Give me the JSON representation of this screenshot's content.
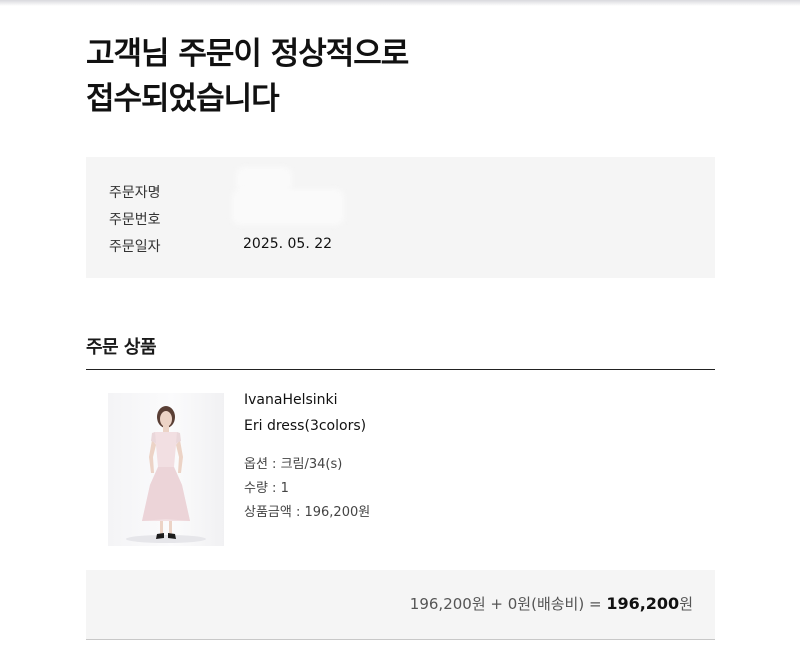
{
  "page": {
    "title_line1": "고객님 주문이 정상적으로",
    "title_line2": "접수되었습니다"
  },
  "order_info": {
    "orderer_label": "주문자명",
    "order_number_label": "주문번호",
    "order_date_label": "주문일자",
    "order_date": "2025. 05. 22"
  },
  "products_section": {
    "title": "주문 상품"
  },
  "product": {
    "brand": "IvanaHelsinki",
    "name": "Eri dress(3colors)",
    "option": "옵션 : 크림/34(s)",
    "quantity": "수량 : 1",
    "price": "상품금액 : 196,200원"
  },
  "summary": {
    "product_total": "196,200원",
    "plus": " + ",
    "shipping": "0원(배송비)",
    "equals": " = ",
    "final_amount": "196,200",
    "final_unit": "원"
  },
  "colors": {
    "panel_bg": "#f5f5f5",
    "divider": "#222222",
    "text": "#111111"
  }
}
